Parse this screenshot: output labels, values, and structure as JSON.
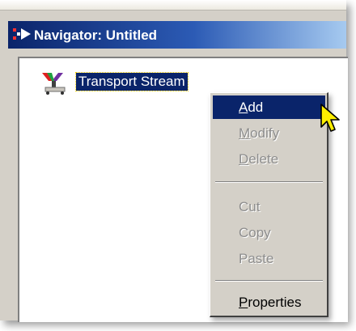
{
  "window": {
    "title": "Navigator: Untitled",
    "title_icon": "navigator-arrow-icon"
  },
  "tree": {
    "nodes": [
      {
        "label": "Transport Stream",
        "icon": "transport-stream-icon",
        "selected": true
      }
    ]
  },
  "context_menu": {
    "items": [
      {
        "label": "Add",
        "mnemonic": "A",
        "rest": "dd",
        "enabled": true,
        "highlighted": true
      },
      {
        "label": "Modify",
        "mnemonic": "M",
        "rest": "odify",
        "enabled": false
      },
      {
        "label": "Delete",
        "mnemonic": "D",
        "rest": "elete",
        "enabled": false
      },
      {
        "label": "Cut",
        "enabled": false
      },
      {
        "label": "Copy",
        "enabled": false
      },
      {
        "label": "Paste",
        "enabled": false
      },
      {
        "label": "Properties",
        "mnemonic": "P",
        "rest": "roperties",
        "enabled": true
      }
    ]
  },
  "colors": {
    "selection": "#0a246a",
    "title_gradient_start": "#0a246a",
    "title_gradient_end": "#a6caf0",
    "disabled_text": "#8d8d8d",
    "cursor_fill": "#ffee00"
  }
}
